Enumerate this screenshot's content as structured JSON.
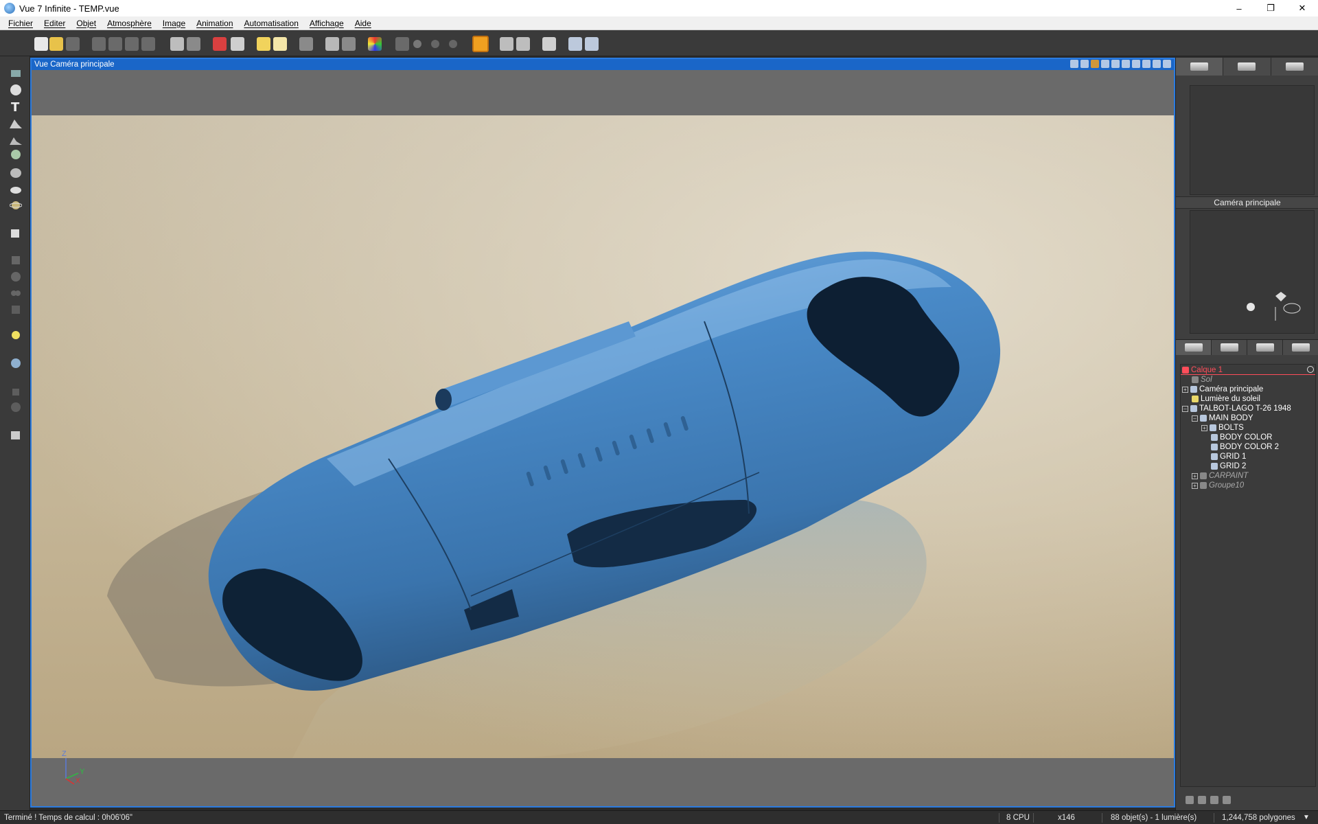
{
  "window": {
    "title": "Vue 7 Infinite - TEMP.vue",
    "min": "–",
    "max": "❐",
    "close": "✕"
  },
  "menu": [
    "Fichier",
    "Editer",
    "Objet",
    "Atmosphère",
    "Image",
    "Animation",
    "Automatisation",
    "Affichage",
    "Aide"
  ],
  "viewport": {
    "title": "Vue Caméra principale",
    "axes": {
      "z": "Z",
      "y": "Y",
      "x": "X"
    }
  },
  "right_panel": {
    "camera_title": "Caméra principale",
    "tree": [
      {
        "label": "Calque 1",
        "type": "layer"
      },
      {
        "label": "Sol",
        "type": "dim"
      },
      {
        "label": "Caméra principale",
        "type": "item"
      },
      {
        "label": "Lumière du soleil",
        "type": "item"
      },
      {
        "label": "TALBOT-LAGO T-26 1948",
        "type": "item"
      },
      {
        "label": "MAIN BODY",
        "type": "item"
      },
      {
        "label": "BOLTS",
        "type": "item"
      },
      {
        "label": "BODY COLOR",
        "type": "item"
      },
      {
        "label": "BODY COLOR 2",
        "type": "item"
      },
      {
        "label": "GRID 1",
        "type": "item"
      },
      {
        "label": "GRID 2",
        "type": "item"
      },
      {
        "label": "CARPAINT",
        "type": "dim"
      },
      {
        "label": "Groupe10",
        "type": "dim"
      }
    ]
  },
  "status": {
    "message": "Terminé ! Temps de calcul : 0h06'06\"",
    "cpu": "8 CPU",
    "zoom": "x146",
    "objects": "88 objet(s) - 1 lumière(s)",
    "polygons": "1,244,758 polygones"
  },
  "colors": {
    "accent": "#1a66c8",
    "car_body": "#3f7fbf",
    "ground": "#c9bca0",
    "layer_red": "#ff4d5a"
  }
}
